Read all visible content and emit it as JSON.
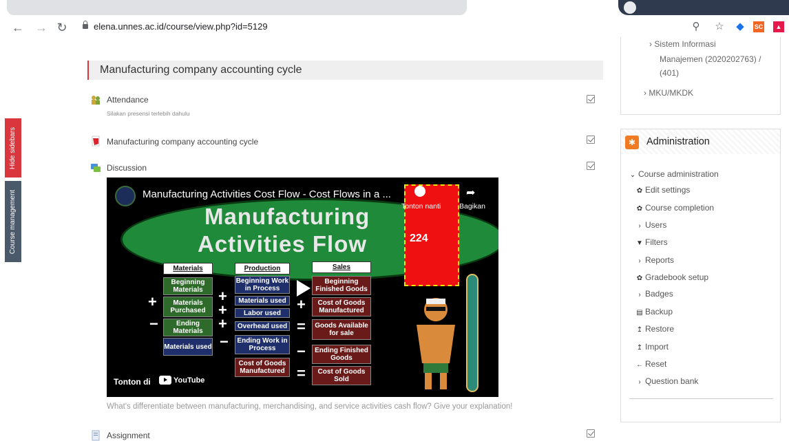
{
  "browser": {
    "url": "elena.unnes.ac.id/course/view.php?id=5129",
    "ext_sc": "SC"
  },
  "side_tabs": {
    "hide": "Hide sidebars",
    "course": "Course management"
  },
  "section": {
    "title": "Manufacturing company accounting cycle"
  },
  "activities": [
    {
      "label": "Attendance",
      "sub": "Silakan presensi terlebih dahulu"
    },
    {
      "label": "Manufacturing company accounting cycle"
    },
    {
      "label": "Discussion"
    },
    {
      "label": "Assignment"
    }
  ],
  "video": {
    "title": "Manufacturing Activities Cost Flow - Cost Flows in a ...",
    "big1": "Manufacturing",
    "big2": "Activities Flow",
    "number": "224",
    "later": "Tonton nanti",
    "share": "Bagikan",
    "watch_on": "Tonton di",
    "youtube": "YouTube",
    "headers": [
      "Materials",
      "Production",
      "Sales"
    ],
    "materials": [
      "Beginning Materials",
      "Materials Purchased",
      "Ending Materials",
      "Materials used"
    ],
    "production": [
      "Beginning Work in Process",
      "Materials used",
      "Labor used",
      "Overhead used",
      "Ending Work in Process",
      "Cost of Goods Manufactured"
    ],
    "sales": [
      "Beginning Finished Goods",
      "Cost of Goods Manufactured",
      "Goods Available for sale",
      "Ending Finished Goods",
      "Cost of Goods Sold"
    ]
  },
  "video_caption": "What's differentiate between manufacturing, merchandising, and service activities cash flow? Give your explanation!",
  "nav_block": {
    "line1": "› Sistem Informasi",
    "line2": "Manajemen (2020202763) /",
    "line3": "(401)",
    "line4": "› MKU/MKDK"
  },
  "admin": {
    "title": "Administration",
    "items": [
      {
        "icon": "⌄",
        "label": "Course administration"
      },
      {
        "icon": "✿",
        "label": "Edit settings"
      },
      {
        "icon": "✿",
        "label": "Course completion"
      },
      {
        "icon": "›",
        "label": "Users"
      },
      {
        "icon": "▼",
        "label": "Filters"
      },
      {
        "icon": "›",
        "label": "Reports"
      },
      {
        "icon": "✿",
        "label": "Gradebook setup"
      },
      {
        "icon": "›",
        "label": "Badges"
      },
      {
        "icon": "▤",
        "label": "Backup"
      },
      {
        "icon": "↥",
        "label": "Restore"
      },
      {
        "icon": "↥",
        "label": "Import"
      },
      {
        "icon": "←",
        "label": "Reset"
      },
      {
        "icon": "›",
        "label": "Question bank"
      }
    ]
  }
}
